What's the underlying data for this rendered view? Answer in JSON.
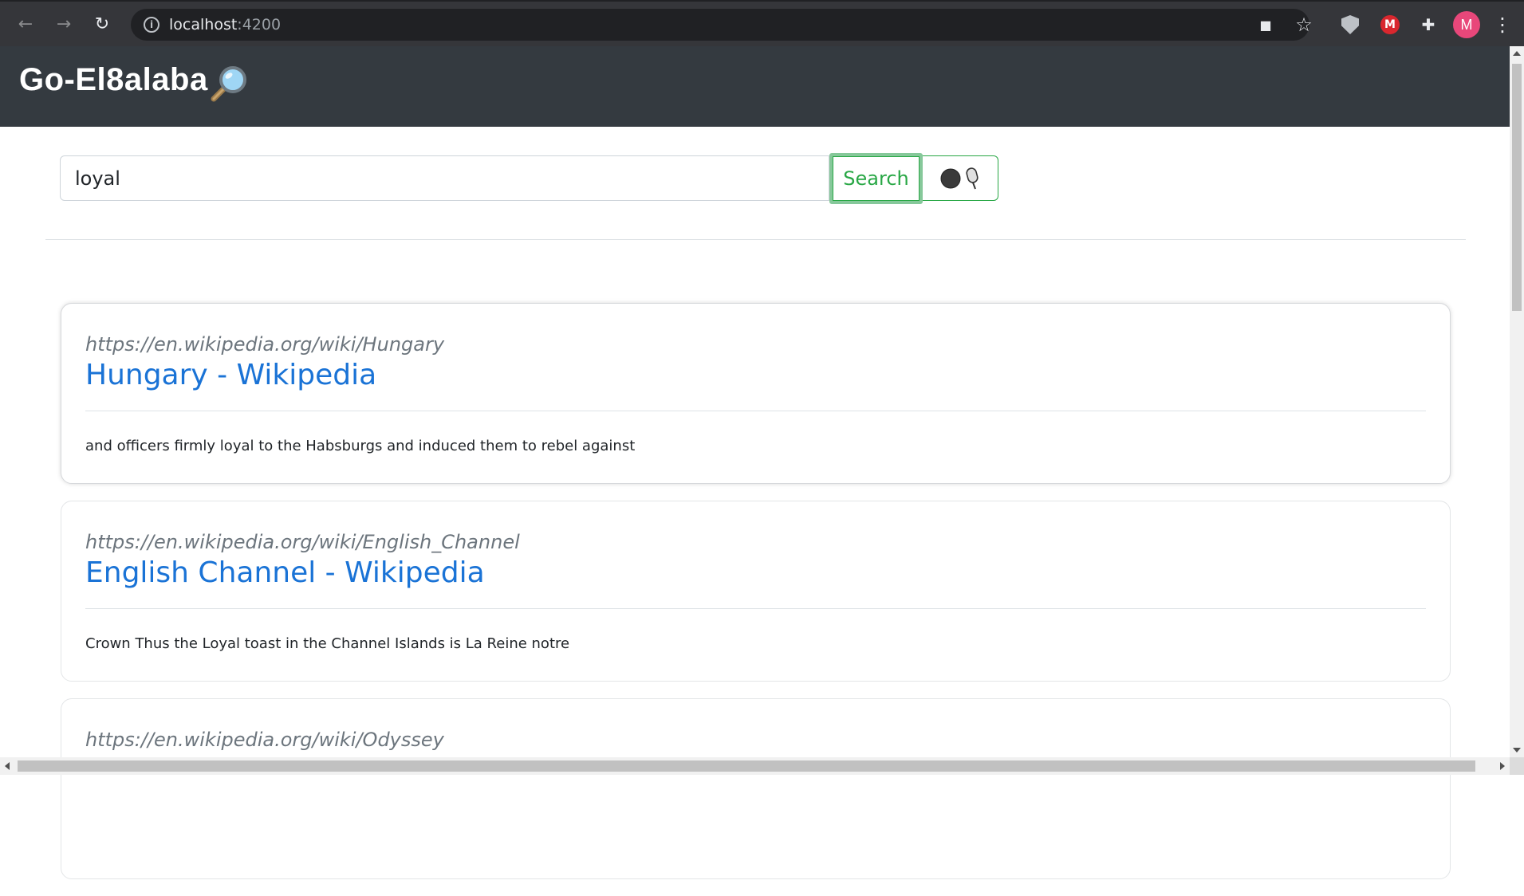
{
  "browser": {
    "back_icon": "←",
    "forward_icon": "→",
    "reload_icon": "↻",
    "info_icon": "i",
    "url_host": "localhost",
    "url_port": ":4200",
    "camera_icon": "■",
    "star_icon": "☆",
    "mega_label": "M",
    "puzzle_icon": "✚",
    "profile_initial": "M",
    "menu_icon": "⋮"
  },
  "header": {
    "brand": "Go-El8alaba"
  },
  "search": {
    "query": "loyal",
    "button_label": "Search"
  },
  "results": [
    {
      "url": "https://en.wikipedia.org/wiki/Hungary",
      "title": "Hungary - Wikipedia",
      "snippet": "and officers firmly loyal to the Habsburgs and induced them to rebel against"
    },
    {
      "url": "https://en.wikipedia.org/wiki/English_Channel",
      "title": "English Channel - Wikipedia",
      "snippet": "Crown Thus the Loyal toast in the Channel Islands is La Reine notre"
    },
    {
      "url": "https://en.wikipedia.org/wiki/Odyssey",
      "title": "",
      "snippet": ""
    }
  ],
  "colors": {
    "header_bg": "#343a40",
    "link": "#1a73d6",
    "success": "#28a745"
  }
}
